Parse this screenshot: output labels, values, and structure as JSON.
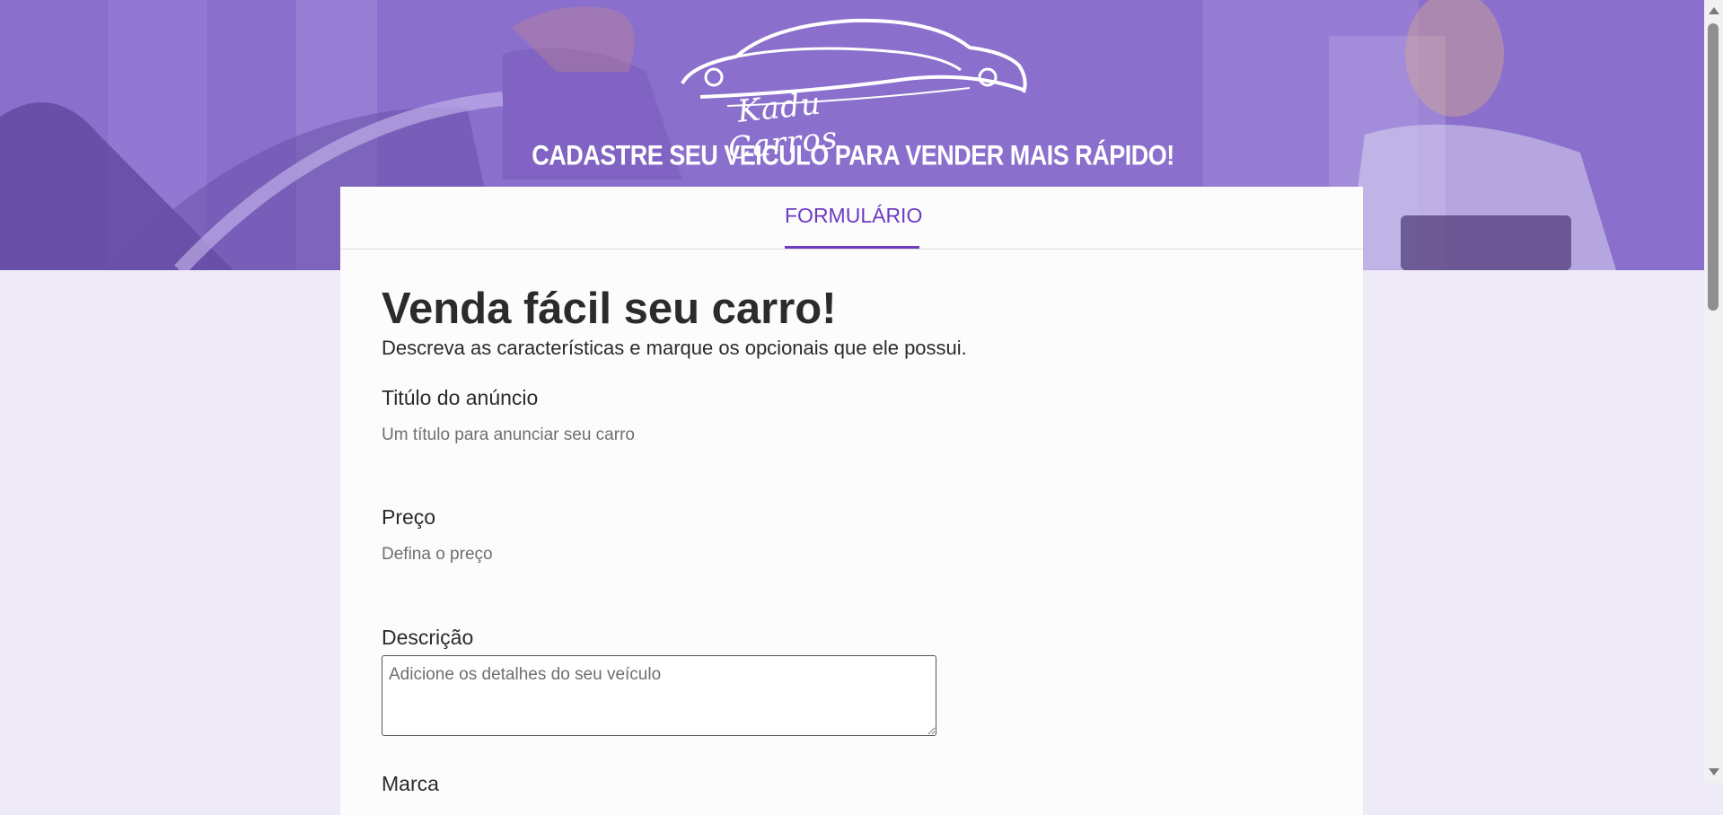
{
  "header": {
    "brand": "Kadu Carros",
    "tagline": "CADASTRE SEU VEÍCULO PARA VENDER MAIS RÁPIDO!"
  },
  "tabs": [
    {
      "label": "FORMULÁRIO",
      "active": true
    }
  ],
  "form": {
    "title": "Venda fácil seu carro!",
    "subtitle": "Descreva as características e marque os opcionais que ele possui.",
    "fields": {
      "titulo": {
        "label": "Titúlo do anúncio",
        "placeholder": "Um título para anunciar seu carro"
      },
      "preco": {
        "label": "Preço",
        "placeholder": "Defina o preço"
      },
      "descricao": {
        "label": "Descrição",
        "placeholder": "Adicione os detalhes do seu veículo"
      },
      "marca": {
        "label": "Marca"
      }
    }
  },
  "colors": {
    "accent": "#6c3bc1",
    "hero": "#8c6fd0",
    "page_bg": "#efeaf8"
  },
  "icons": {
    "logo": "car-outline-logo-icon"
  }
}
